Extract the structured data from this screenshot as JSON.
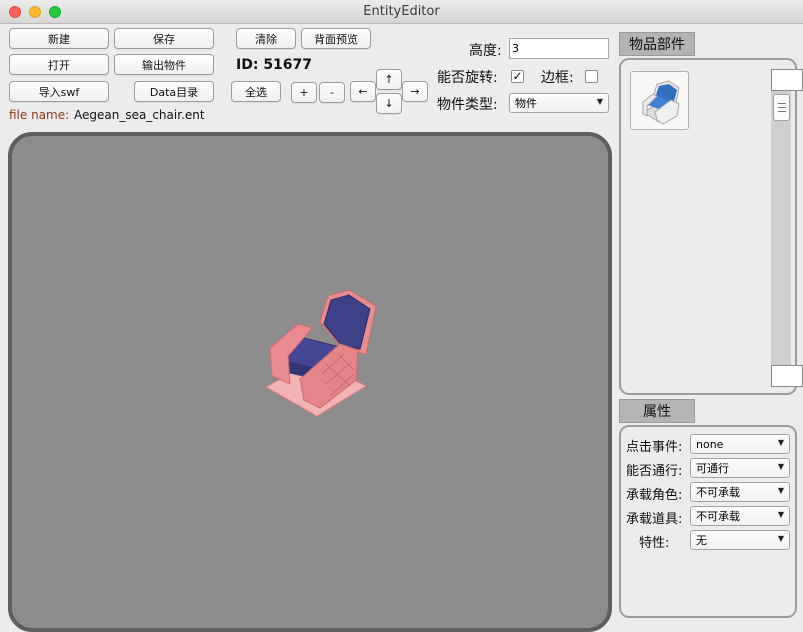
{
  "window": {
    "title": "EntityEditor"
  },
  "toolbar": {
    "new_label": "新建",
    "save_label": "保存",
    "open_label": "打开",
    "export_label": "输出物件",
    "import_label": "导入swf",
    "data_dir_label": "Data目录",
    "clear_label": "清除",
    "back_preview_label": "背面预览",
    "select_all_label": "全选",
    "plus_label": "+",
    "minus_label": "-",
    "left_label": "←",
    "up_label": "↑",
    "down_label": "↓",
    "right_label": "→"
  },
  "file": {
    "label": "file name:",
    "value": "Aegean_sea_chair.ent"
  },
  "id": {
    "label": "ID:",
    "value": "51677"
  },
  "props_top": {
    "height_label": "高度:",
    "height_value": "3",
    "rotate_label": "能否旋转:",
    "rotate_checked": true,
    "border_label": "边框:",
    "border_checked": false,
    "type_label": "物件类型:",
    "type_value": "物件"
  },
  "parts_panel": {
    "title": "物品部件",
    "items": [
      {
        "icon": "chair-thumbnail-icon"
      }
    ]
  },
  "attrs_panel": {
    "title": "属性",
    "rows": [
      {
        "label": "点击事件:",
        "value": "none"
      },
      {
        "label": "能否通行:",
        "value": "可通行"
      },
      {
        "label": "承载角色:",
        "value": "不可承载"
      },
      {
        "label": "承载道具:",
        "value": "不可承载"
      },
      {
        "label": "特性:",
        "value": "无"
      }
    ]
  },
  "colors": {
    "canvas_bg": "#8c8c8c",
    "canvas_border": "#5e5e5e",
    "chair_frame": "#e7848a",
    "chair_cushion": "#3e3f8a"
  }
}
